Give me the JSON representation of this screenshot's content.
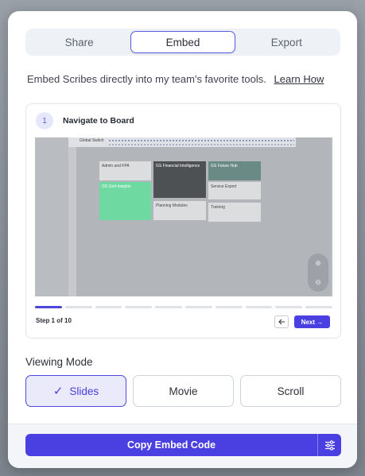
{
  "tabs": [
    {
      "label": "Share"
    },
    {
      "label": "Embed"
    },
    {
      "label": "Export"
    }
  ],
  "description": {
    "text": "Embed Scribes directly into my team's favorite tools.",
    "link": "Learn How"
  },
  "preview": {
    "step_number": "1",
    "step_title": "Navigate to Board",
    "screenshot": {
      "board_title": "Global Switch",
      "tiles": [
        "Admin and FPA",
        "GS Grid Insights",
        "GS Financial Intelligence",
        "Planning Modules",
        "GS Future Hub",
        "Service Export",
        "Training"
      ]
    },
    "progress": {
      "current": 1,
      "total": 10
    },
    "step_count": "Step 1 of 10",
    "next_label": "Next →",
    "prev_icon": "arrow-left-icon",
    "zoom_in": "⊕",
    "zoom_out": "⊖"
  },
  "viewing_mode": {
    "label": "Viewing Mode",
    "options": [
      {
        "label": "Slides",
        "selected": true
      },
      {
        "label": "Movie",
        "selected": false
      },
      {
        "label": "Scroll",
        "selected": false
      }
    ]
  },
  "footer": {
    "copy_label": "Copy Embed Code",
    "settings_icon": "sliders-icon"
  },
  "colors": {
    "accent": "#4a3fe0",
    "active_bg": "#eaeafb"
  }
}
